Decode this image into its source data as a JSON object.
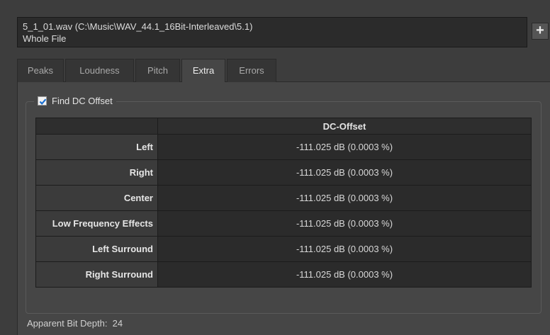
{
  "file": {
    "path": "5_1_01.wav (C:\\Music\\WAV_44.1_16Bit-Interleaved\\5.1)",
    "range": "Whole File"
  },
  "add_button_label": "+",
  "tabs": [
    {
      "label": "Peaks",
      "active": false
    },
    {
      "label": "Loudness",
      "active": false
    },
    {
      "label": "Pitch",
      "active": false
    },
    {
      "label": "Extra",
      "active": true
    },
    {
      "label": "Errors",
      "active": false
    }
  ],
  "dc_group": {
    "label": "Find DC Offset",
    "checked": true
  },
  "table": {
    "column_header": "DC-Offset",
    "rows": [
      {
        "channel": "Left",
        "value": "-111.025 dB (0.0003 %)"
      },
      {
        "channel": "Right",
        "value": "-111.025 dB (0.0003 %)"
      },
      {
        "channel": "Center",
        "value": "-111.025 dB (0.0003 %)"
      },
      {
        "channel": "Low Frequency Effects",
        "value": "-111.025 dB (0.0003 %)"
      },
      {
        "channel": "Left Surround",
        "value": "-111.025 dB (0.0003 %)"
      },
      {
        "channel": "Right Surround",
        "value": "-111.025 dB (0.0003 %)"
      }
    ]
  },
  "bit_depth": "Apparent Bit Depth:  24",
  "icons": {
    "checkbox": "checkmark-icon",
    "add": "plus-icon"
  },
  "colors": {
    "background": "#3d3d3d",
    "panel": "#464646",
    "cell": "#2b2b2b",
    "check": "#1a6fd0"
  }
}
